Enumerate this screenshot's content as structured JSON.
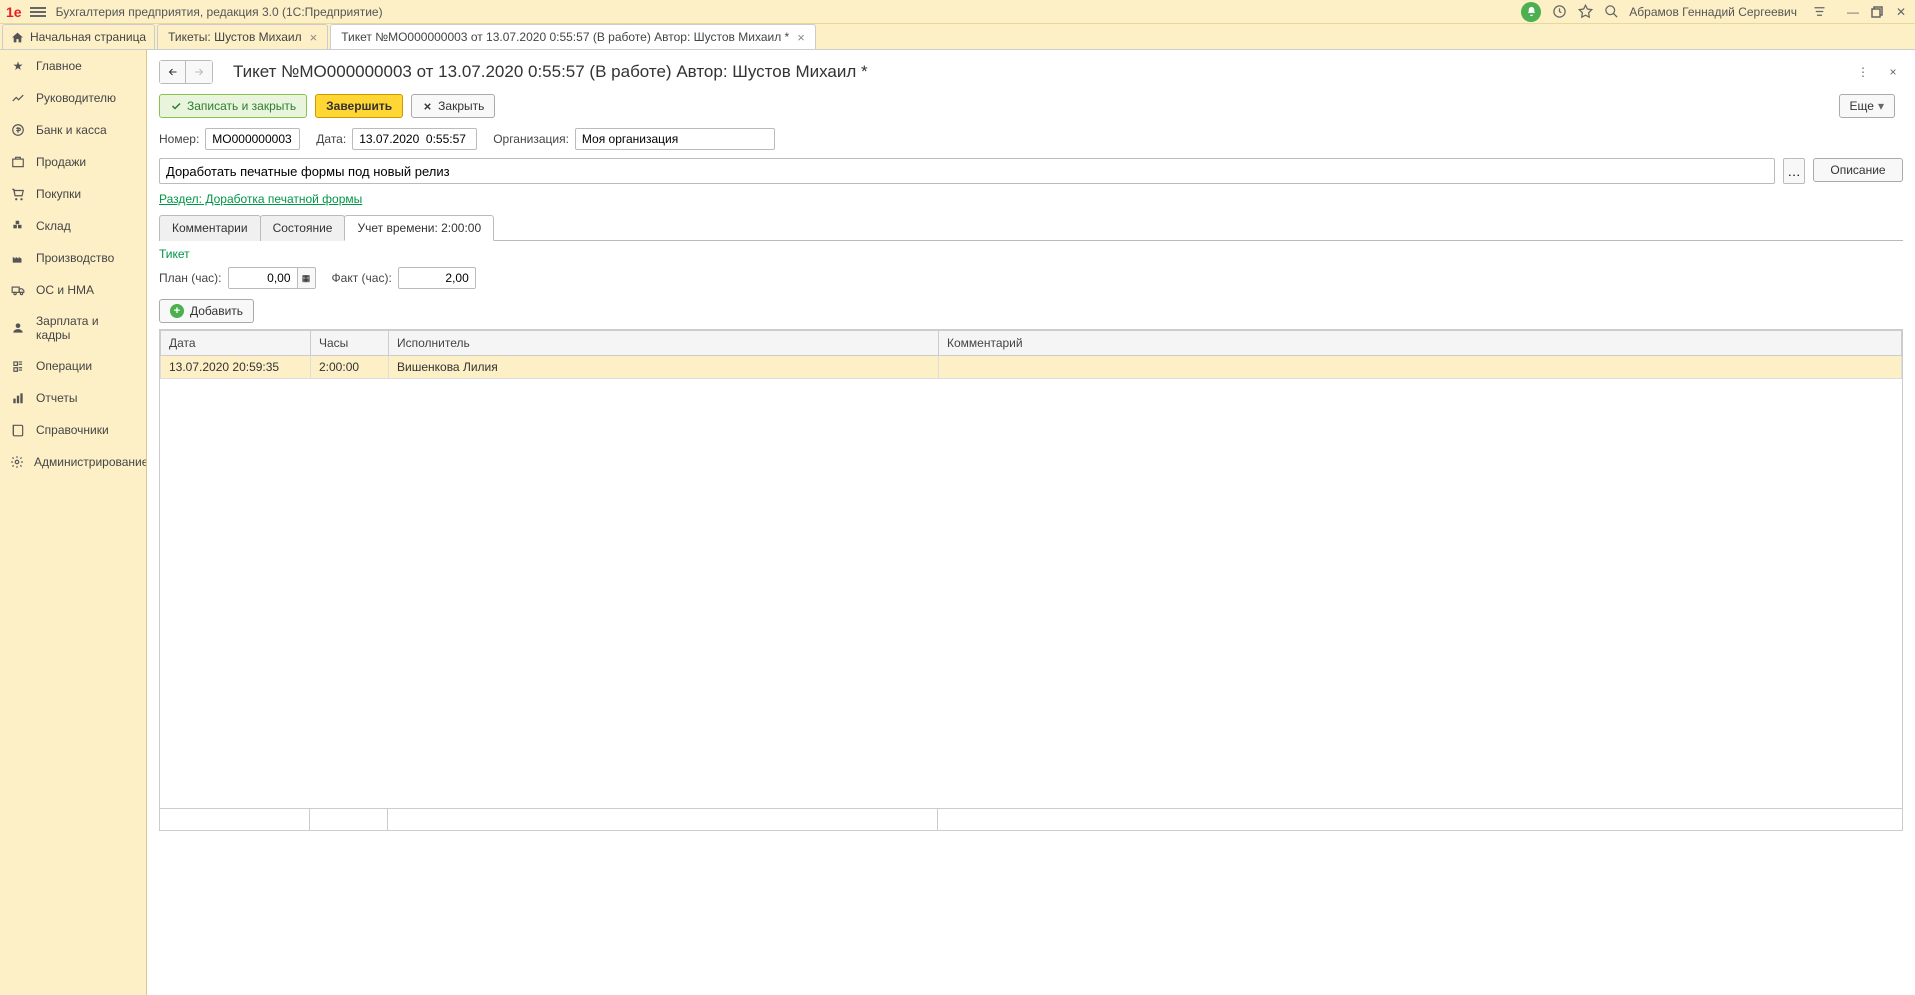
{
  "app": {
    "title": "Бухгалтерия предприятия, редакция 3.0  (1С:Предприятие)",
    "user": "Абрамов Геннадий Сергеевич"
  },
  "tabs": {
    "home": "Начальная страница",
    "tab1": "Тикеты: Шустов Михаил",
    "tab2": "Тикет №МО000000003 от 13.07.2020 0:55:57 (В работе) Автор: Шустов Михаил *"
  },
  "sidebar": {
    "main": "Главное",
    "manager": "Руководителю",
    "bank": "Банк и касса",
    "sales": "Продажи",
    "purchases": "Покупки",
    "warehouse": "Склад",
    "production": "Производство",
    "assets": "ОС и НМА",
    "salary": "Зарплата и кадры",
    "operations": "Операции",
    "reports": "Отчеты",
    "references": "Справочники",
    "admin": "Администрирование"
  },
  "page": {
    "title": "Тикет №МО000000003 от 13.07.2020 0:55:57 (В работе) Автор: Шустов Михаил *"
  },
  "toolbar": {
    "save_close": "Записать и закрыть",
    "complete": "Завершить",
    "close": "Закрыть",
    "more": "Еще"
  },
  "form": {
    "number_label": "Номер:",
    "number_value": "МО000000003",
    "date_label": "Дата:",
    "date_value": "13.07.2020  0:55:57",
    "org_label": "Организация:",
    "org_value": "Моя организация",
    "description": "Доработать печатные формы под новый релиз",
    "desc_btn": "Описание",
    "section_link": "Раздел: Доработка печатной формы"
  },
  "inner_tabs": {
    "comments": "Комментарии",
    "status": "Состояние",
    "time": "Учет времени: 2:00:00"
  },
  "time_section": {
    "ticket_label": "Тикет",
    "plan_label": "План (час):",
    "plan_value": "0,00",
    "fact_label": "Факт (час):",
    "fact_value": "2,00",
    "add_btn": "Добавить"
  },
  "table": {
    "col_date": "Дата",
    "col_hours": "Часы",
    "col_executor": "Исполнитель",
    "col_comment": "Комментарий",
    "row1": {
      "date": "13.07.2020 20:59:35",
      "hours": "2:00:00",
      "executor": "Вишенкова Лилия",
      "comment": ""
    }
  }
}
